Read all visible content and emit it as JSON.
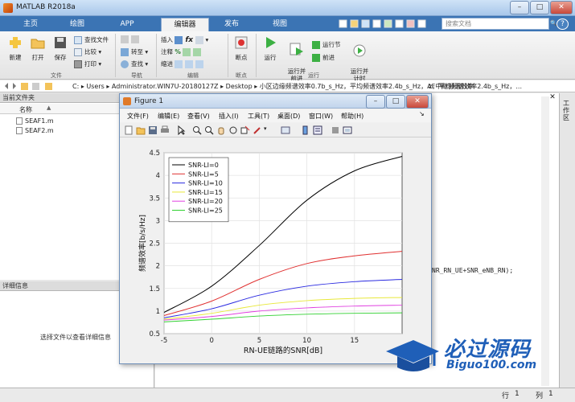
{
  "app": {
    "title": "MATLAB R2018a"
  },
  "tabs": [
    "主页",
    "绘图",
    "APP",
    "编辑器",
    "发布",
    "视图"
  ],
  "search": {
    "placeholder": "搜索文档"
  },
  "ribbon": {
    "file": {
      "label": "文件",
      "new": "新建",
      "open": "打开",
      "save": "保存",
      "find_files": "查找文件",
      "compare": "比较",
      "print": "打印"
    },
    "nav": {
      "label": "导航",
      "goto": "转至",
      "find": "查找"
    },
    "edit": {
      "label": "编辑",
      "insert": "插入",
      "comment": "注释",
      "indent": "缩进"
    },
    "breakpoints": {
      "label": "断点",
      "breakpoint": "断点"
    },
    "run": {
      "label": "运行",
      "run": "运行",
      "run_advance": "运行并\n前进",
      "run_section": "运行节",
      "advance": "前进",
      "run_time": "运行并\n计时"
    }
  },
  "path": {
    "segments": [
      "C:",
      "Users",
      "Administrator.WIN7U-20180127Z",
      "Desktop",
      "小区边缘频谱效率0.7b_s_Hz，平均频谱效率2.4b_s_Hz，AF中继频谱效率"
    ],
    "right_fragment": "z，平均频谱效率2.4b_s_Hz，..."
  },
  "file_panel": {
    "title": "当前文件夹",
    "column": "名称",
    "files": [
      "SEAF1.m",
      "SEAF2.m"
    ]
  },
  "detail_panel": {
    "title": "详细信息",
    "hint": "选择文件以查看详细信息"
  },
  "command": {
    "visible_code": "NR_RN_UE+SNR_eNB_RN);"
  },
  "right_tab": "工作区",
  "status": {
    "row_label": "行",
    "row": "1",
    "col_label": "列",
    "col": "1"
  },
  "figure": {
    "title": "Figure 1",
    "menus": [
      "文件(F)",
      "编辑(E)",
      "查看(V)",
      "插入(I)",
      "工具(T)",
      "桌面(D)",
      "窗口(W)",
      "帮助(H)"
    ]
  },
  "watermark": {
    "main": "必过源码",
    "sub": "Biguo100.com"
  },
  "chart_data": {
    "type": "line",
    "title": "",
    "xlabel": "RN-UE链路的SNR[dB]",
    "ylabel": "频谱效率[b/s/Hz]",
    "xlim": [
      -5,
      20
    ],
    "ylim": [
      0.5,
      4.5
    ],
    "xticks": [
      -5,
      0,
      5,
      10,
      15
    ],
    "yticks": [
      0.5,
      1,
      1.5,
      2,
      2.5,
      3,
      3.5,
      4,
      4.5
    ],
    "grid": true,
    "legend_position": "top-left",
    "x": [
      -5,
      0,
      5,
      10,
      15,
      20
    ],
    "series": [
      {
        "name": "SNR-LI=0",
        "color": "#000000",
        "values": [
          0.97,
          1.55,
          2.45,
          3.45,
          4.1,
          4.42
        ]
      },
      {
        "name": "SNR-LI=5",
        "color": "#e03030",
        "values": [
          0.9,
          1.22,
          1.7,
          2.05,
          2.22,
          2.32
        ]
      },
      {
        "name": "SNR-LI=10",
        "color": "#2a2ae0",
        "values": [
          0.85,
          1.05,
          1.35,
          1.55,
          1.65,
          1.7
        ]
      },
      {
        "name": "SNR-LI=15",
        "color": "#e8e83a",
        "values": [
          0.82,
          0.95,
          1.13,
          1.23,
          1.28,
          1.3
        ]
      },
      {
        "name": "SNR-LI=20",
        "color": "#e040e0",
        "values": [
          0.8,
          0.88,
          1.0,
          1.07,
          1.11,
          1.13
        ]
      },
      {
        "name": "SNR-LI=25",
        "color": "#30d030",
        "values": [
          0.76,
          0.82,
          0.89,
          0.93,
          0.95,
          0.96
        ]
      }
    ]
  }
}
